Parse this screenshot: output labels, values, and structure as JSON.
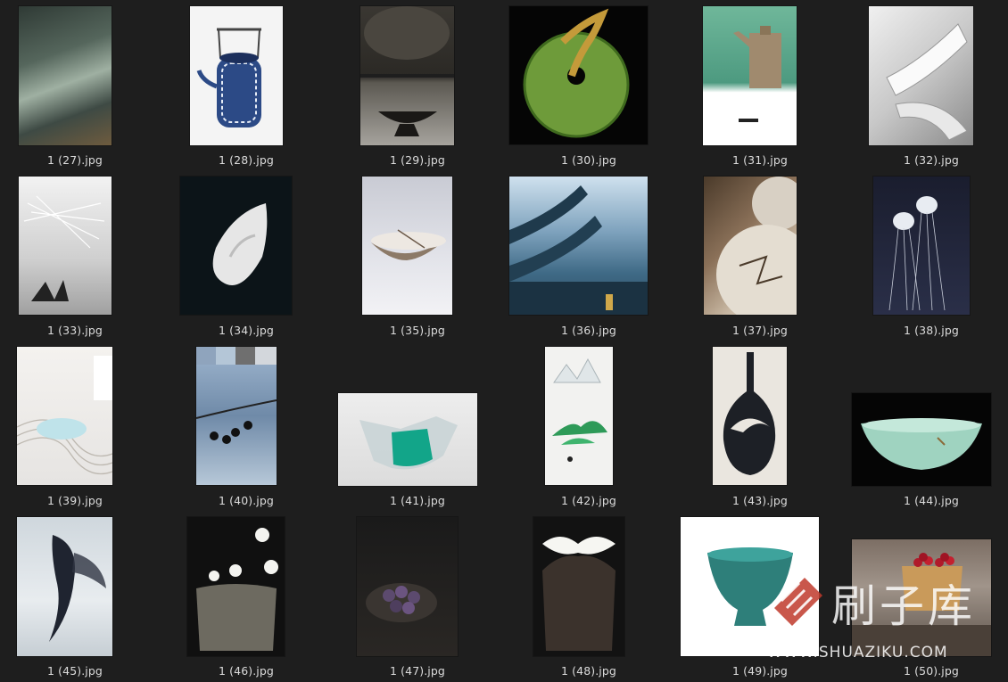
{
  "files": [
    {
      "name": "1 (27).jpg",
      "icon": "photo-thumbnail"
    },
    {
      "name": "1 (28).jpg",
      "icon": "photo-thumbnail"
    },
    {
      "name": "1 (29).jpg",
      "icon": "photo-thumbnail"
    },
    {
      "name": "1 (30).jpg",
      "icon": "photo-thumbnail"
    },
    {
      "name": "1 (31).jpg",
      "icon": "photo-thumbnail"
    },
    {
      "name": "1 (32).jpg",
      "icon": "photo-thumbnail"
    },
    {
      "name": "1 (33).jpg",
      "icon": "photo-thumbnail"
    },
    {
      "name": "1 (34).jpg",
      "icon": "photo-thumbnail"
    },
    {
      "name": "1 (35).jpg",
      "icon": "photo-thumbnail"
    },
    {
      "name": "1 (36).jpg",
      "icon": "photo-thumbnail"
    },
    {
      "name": "1 (37).jpg",
      "icon": "photo-thumbnail"
    },
    {
      "name": "1 (38).jpg",
      "icon": "photo-thumbnail"
    },
    {
      "name": "1 (39).jpg",
      "icon": "photo-thumbnail"
    },
    {
      "name": "1 (40).jpg",
      "icon": "photo-thumbnail"
    },
    {
      "name": "1 (41).jpg",
      "icon": "photo-thumbnail"
    },
    {
      "name": "1 (42).jpg",
      "icon": "photo-thumbnail"
    },
    {
      "name": "1 (43).jpg",
      "icon": "photo-thumbnail"
    },
    {
      "name": "1 (44).jpg",
      "icon": "photo-thumbnail"
    },
    {
      "name": "1 (45).jpg",
      "icon": "photo-thumbnail"
    },
    {
      "name": "1 (46).jpg",
      "icon": "photo-thumbnail"
    },
    {
      "name": "1 (47).jpg",
      "icon": "photo-thumbnail"
    },
    {
      "name": "1 (48).jpg",
      "icon": "photo-thumbnail"
    },
    {
      "name": "1 (49).jpg",
      "icon": "photo-thumbnail"
    },
    {
      "name": "1 (50).jpg",
      "icon": "photo-thumbnail"
    }
  ],
  "watermark": {
    "text": "刷子库",
    "url": "WWW.SHUAZIKU.COM"
  },
  "colors": {
    "background": "#1e1e1e",
    "caption": "#dcdcdc",
    "watermark_logo": "#c0392b"
  }
}
